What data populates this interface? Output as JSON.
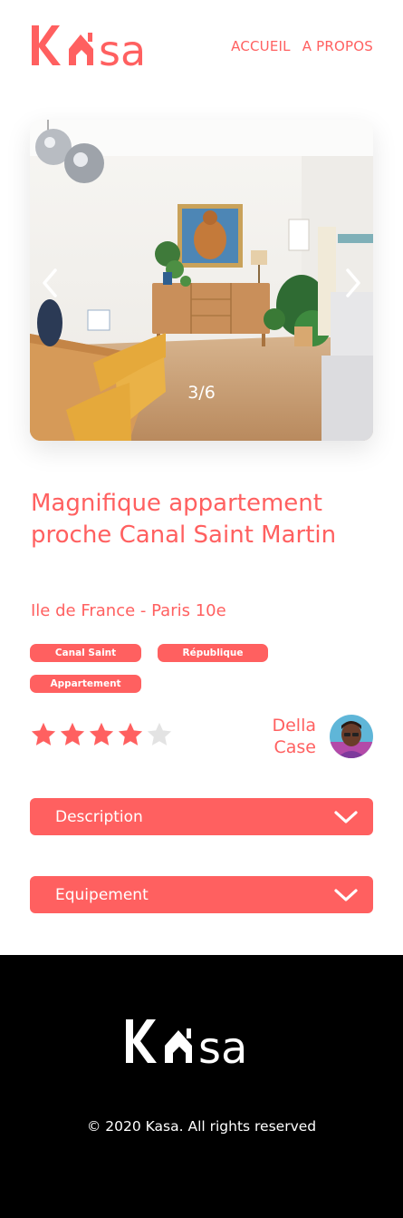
{
  "brand": {
    "accent": "#FF6060",
    "logo_text": "Kasa"
  },
  "nav": {
    "home": "ACCUEIL",
    "about": "A PROPOS"
  },
  "carousel": {
    "counter": "3/6",
    "prev_icon": "chevron-left-icon",
    "next_icon": "chevron-right-icon"
  },
  "listing": {
    "title": "Magnifique appartement proche Canal Saint Martin",
    "location": "Ile de France - Paris 10e",
    "tags": [
      "Canal Saint Martin",
      "République",
      "Appartement"
    ],
    "rating": 4,
    "rating_max": 5,
    "host": {
      "first_name": "Della",
      "last_name": "Case"
    }
  },
  "collapses": [
    {
      "label": "Description",
      "icon": "chevron-down-icon"
    },
    {
      "label": "Equipement",
      "icon": "chevron-down-icon"
    }
  ],
  "footer": {
    "copyright": "© 2020 Kasa. All rights reserved"
  }
}
